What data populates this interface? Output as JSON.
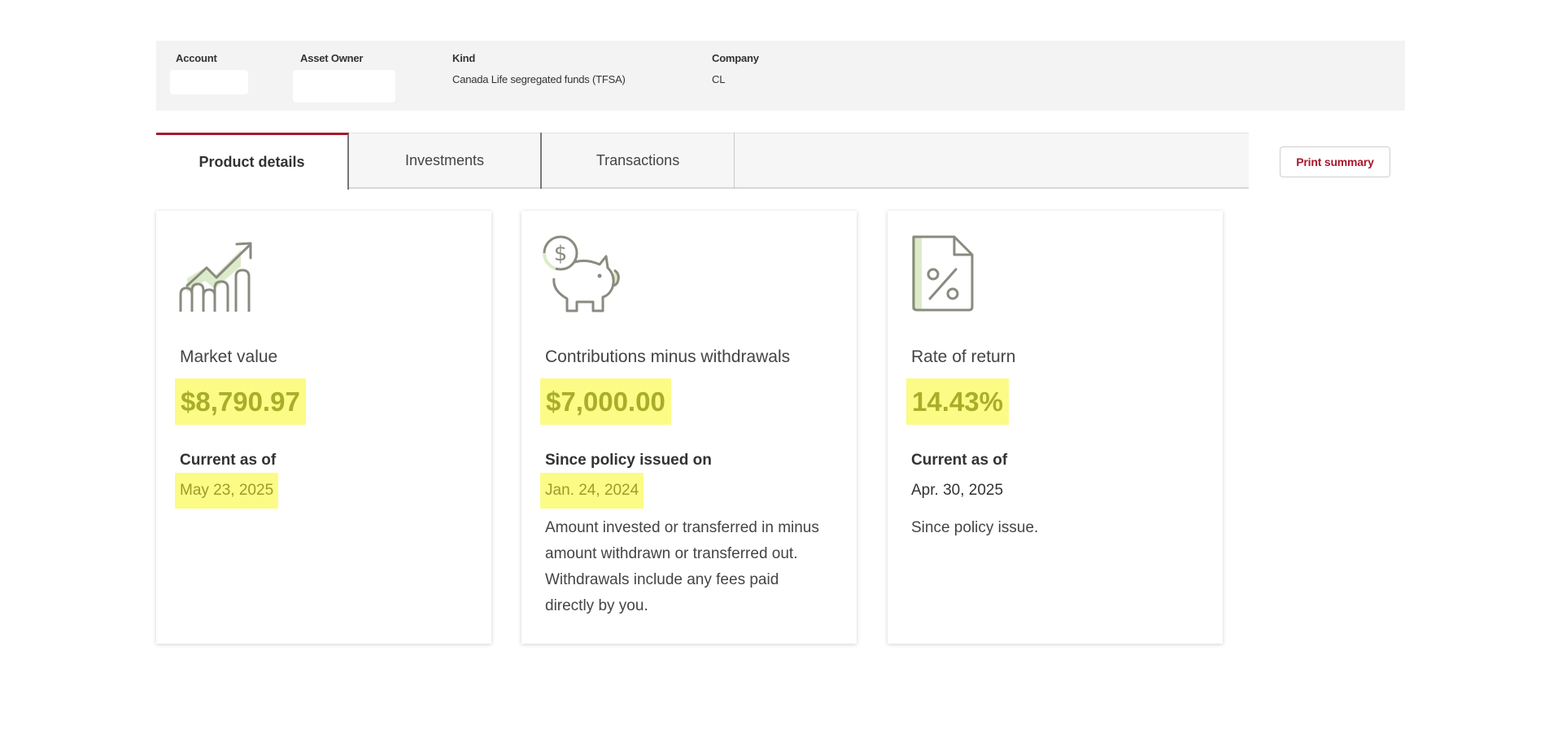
{
  "account_info": {
    "account_label": "Account",
    "asset_owner_label": "Asset Owner",
    "kind_label": "Kind",
    "kind_value": "Canada Life segregated funds (TFSA)",
    "company_label": "Company",
    "company_value": "CL"
  },
  "tabs": [
    {
      "label": "Product details",
      "active": true
    },
    {
      "label": "Investments",
      "active": false
    },
    {
      "label": "Transactions",
      "active": false
    }
  ],
  "print_button_label": "Print summary",
  "cards": [
    {
      "icon": "growth-chart-icon",
      "title": "Market value",
      "value": "$8,790.97",
      "sublabel": "Current as of",
      "date": "May 23, 2025",
      "note": ""
    },
    {
      "icon": "piggy-bank-icon",
      "title": "Contributions minus withdrawals",
      "value": "$7,000.00",
      "sublabel": "Since policy issued on",
      "date": "Jan. 24, 2024",
      "note": "Amount invested or transferred in minus amount withdrawn or transferred out. Withdrawals include any fees paid directly by you."
    },
    {
      "icon": "percent-document-icon",
      "title": "Rate of return",
      "value": "14.43%",
      "sublabel": "Current as of",
      "date": "Apr. 30, 2025",
      "note": "Since policy issue."
    }
  ],
  "colors": {
    "accent": "#a6192e",
    "highlight": "#fbfb86",
    "value_text": "#a8ad2a"
  }
}
